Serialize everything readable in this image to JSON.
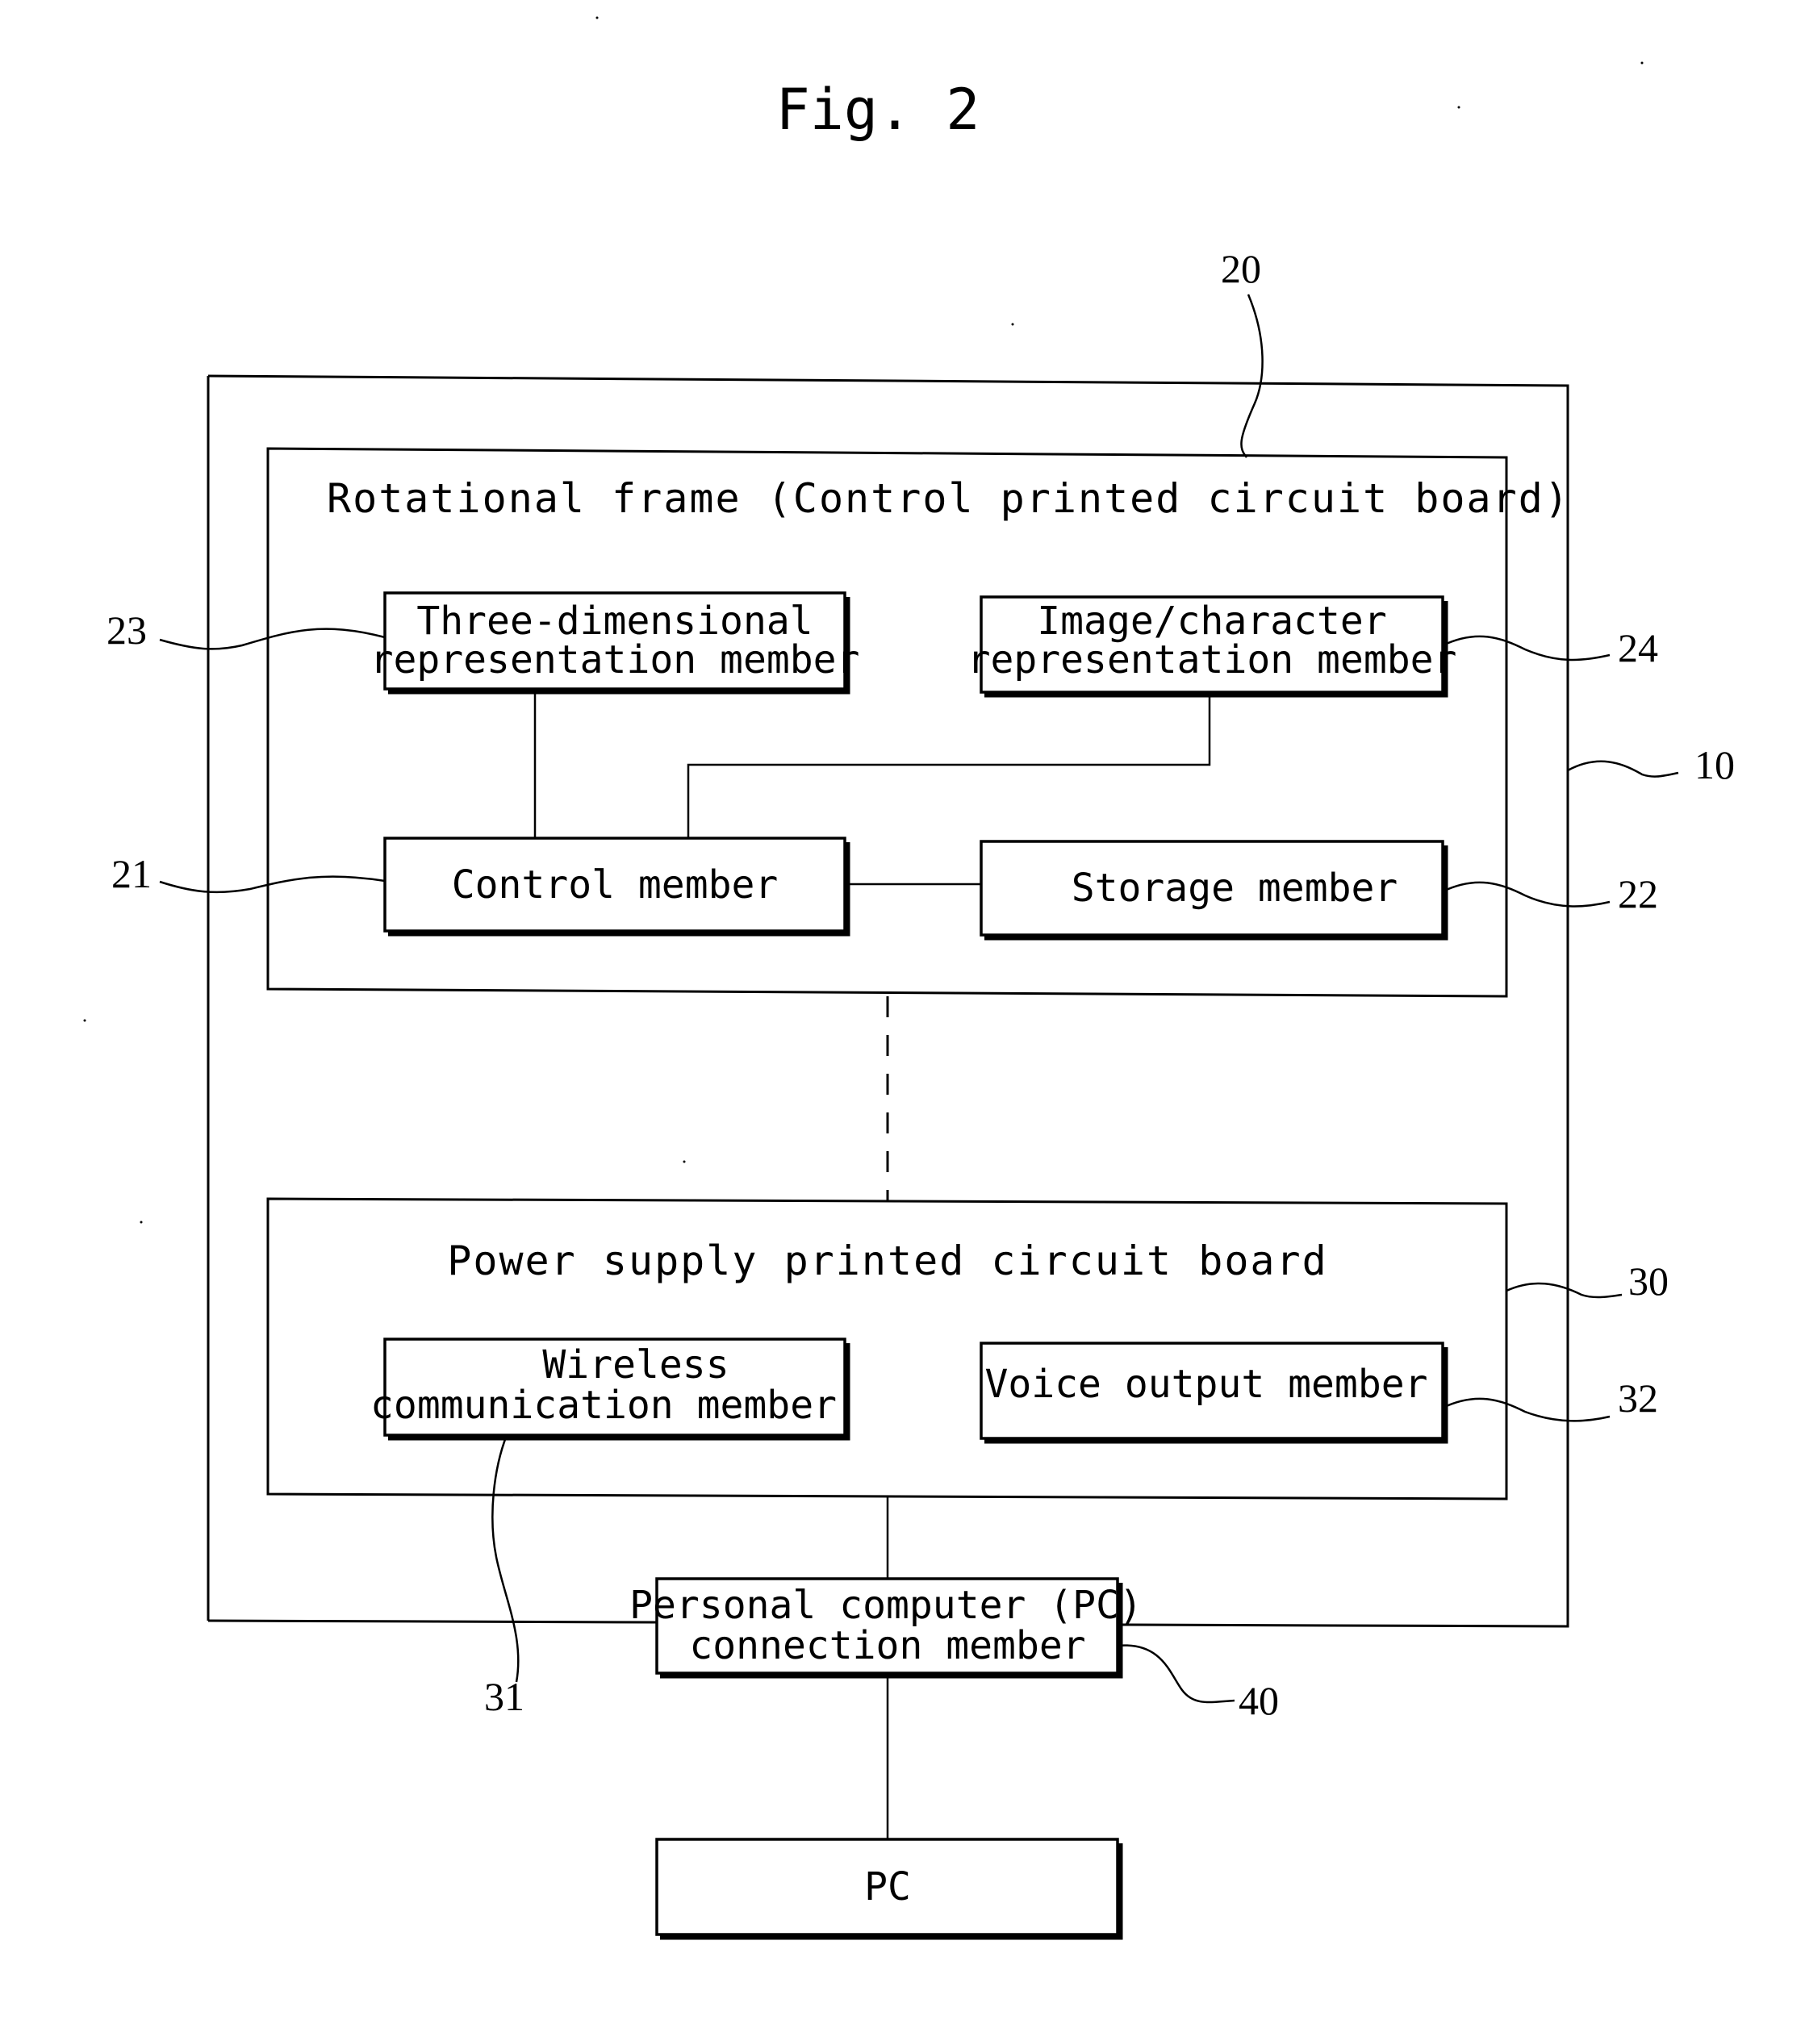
{
  "figure": {
    "title": "Fig. 2"
  },
  "frames": {
    "housing": {
      "ref": "10"
    },
    "rotational_frame": {
      "title": "Rotational frame (Control printed circuit board)",
      "ref": "20"
    },
    "power_board": {
      "title": "Power supply printed circuit board",
      "ref": "30"
    }
  },
  "blocks": {
    "three_d": {
      "lines": [
        "Three-dimensional",
        "representation member"
      ],
      "ref": "23"
    },
    "image_char": {
      "lines": [
        "Image/character",
        "representation member"
      ],
      "ref": "24"
    },
    "control": {
      "lines": [
        "Control member"
      ],
      "ref": "21"
    },
    "storage": {
      "lines": [
        "Storage member"
      ],
      "ref": "22"
    },
    "wireless": {
      "lines": [
        "Wireless",
        "communication member"
      ],
      "ref": "31"
    },
    "voice": {
      "lines": [
        "Voice output member"
      ],
      "ref": "32"
    },
    "pc_connection": {
      "lines": [
        "Personal computer (PC)",
        "connection member"
      ],
      "ref": "40"
    },
    "pc": {
      "lines": [
        "PC"
      ]
    }
  }
}
